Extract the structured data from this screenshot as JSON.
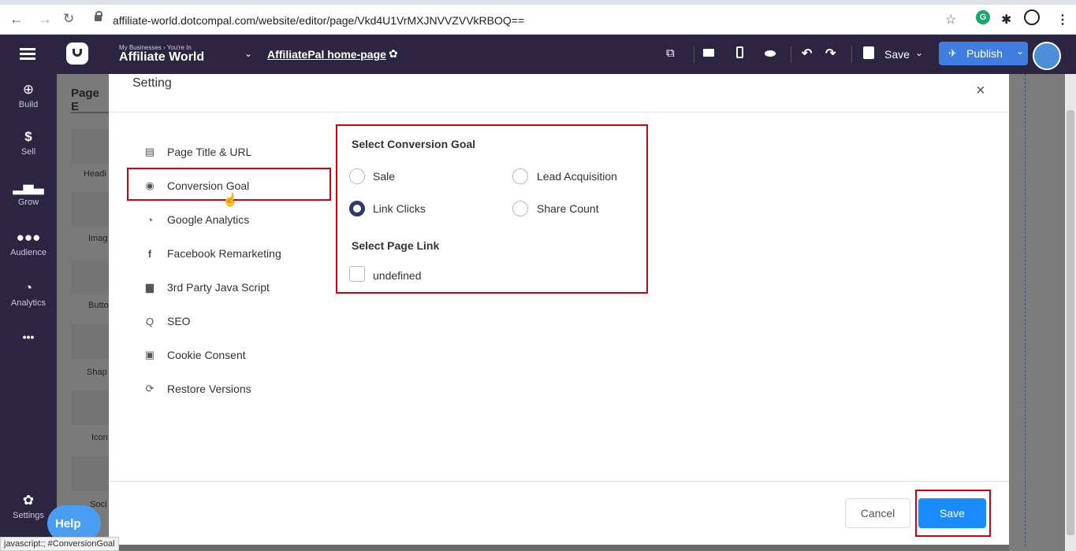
{
  "browser": {
    "url": "affiliate-world.dotcompal.com/website/editor/page/Vkd4U1VrMXJNVVZVVkRBOQ=="
  },
  "app": {
    "breadcrumb_small": "My Businesses › You're In",
    "business_name": "Affiliate World",
    "page_name": "AffiliatePal home-page",
    "save_label": "Save",
    "publish_label": "Publish"
  },
  "sidebar": {
    "items": [
      {
        "label": "Build",
        "icon": "plus-circle-icon"
      },
      {
        "label": "Sell",
        "icon": "dollar-icon"
      },
      {
        "label": "Grow",
        "icon": "bar-chart-icon"
      },
      {
        "label": "Audience",
        "icon": "people-icon"
      },
      {
        "label": "Analytics",
        "icon": "analytics-icon"
      },
      {
        "label": "•••",
        "icon": "more-icon"
      }
    ],
    "settings_label": "Settings",
    "help_label": "Help"
  },
  "leftpanel": {
    "title": "Page E",
    "items": [
      "Headi",
      "Imag",
      "Butto",
      "Shap",
      "Icon",
      "Soci"
    ]
  },
  "modal": {
    "title": "Setting",
    "close": "×",
    "menu": [
      {
        "label": "Page Title & URL",
        "icon": "list-icon"
      },
      {
        "label": "Conversion Goal",
        "icon": "target-icon"
      },
      {
        "label": "Google Analytics",
        "icon": "analytics-icon"
      },
      {
        "label": "Facebook Remarketing",
        "icon": "facebook-icon"
      },
      {
        "label": "3rd Party Java Script",
        "icon": "script-icon"
      },
      {
        "label": "SEO",
        "icon": "search-icon"
      },
      {
        "label": "Cookie Consent",
        "icon": "cookie-icon"
      },
      {
        "label": "Restore Versions",
        "icon": "restore-icon"
      }
    ],
    "conversion": {
      "title": "Select Conversion Goal",
      "options": [
        {
          "label": "Sale",
          "selected": false
        },
        {
          "label": "Lead Acquisition",
          "selected": false
        },
        {
          "label": "Link Clicks",
          "selected": true
        },
        {
          "label": "Share Count",
          "selected": false
        }
      ],
      "page_link_title": "Select Page Link",
      "page_link_option": "undefined"
    },
    "cancel_label": "Cancel",
    "save_label": "Save"
  },
  "statusbar": "javascript:; #ConversionGoal",
  "colors": {
    "appbar": "#2b2542",
    "publish": "#3f7de0",
    "save_button": "#1a8cff",
    "highlight": "#d9000d"
  }
}
